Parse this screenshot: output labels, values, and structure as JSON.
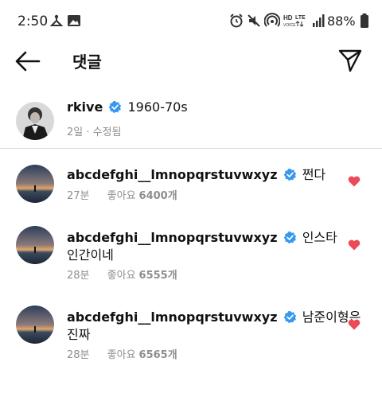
{
  "status_bar": {
    "time": "2:50",
    "battery": "88%"
  },
  "header": {
    "title": "댓글"
  },
  "caption": {
    "username": "rkive",
    "text": "1960-70s",
    "meta": "2일 · 수정됨"
  },
  "comments": [
    {
      "username": "abcdefghi__lmnopqrstuvwxyz",
      "text_line1": "쩐다",
      "text_line2": "",
      "time": "27분",
      "likes_label": "좋아요",
      "likes_count": "6400개",
      "liked": true
    },
    {
      "username": "abcdefghi__lmnopqrstuvwxyz",
      "text_line1": "인스타",
      "text_line2": "인간이네",
      "time": "28분",
      "likes_label": "좋아요",
      "likes_count": "6555개",
      "liked": true
    },
    {
      "username": "abcdefghi__lmnopqrstuvwxyz",
      "text_line1": "남준이형은",
      "text_line2": "진짜",
      "time": "28분",
      "likes_label": "좋아요",
      "likes_count": "6565개",
      "liked": true
    }
  ],
  "colors": {
    "heart": "#ed4956",
    "verified": "#3897f0",
    "meta_text": "#8e8e8e"
  }
}
